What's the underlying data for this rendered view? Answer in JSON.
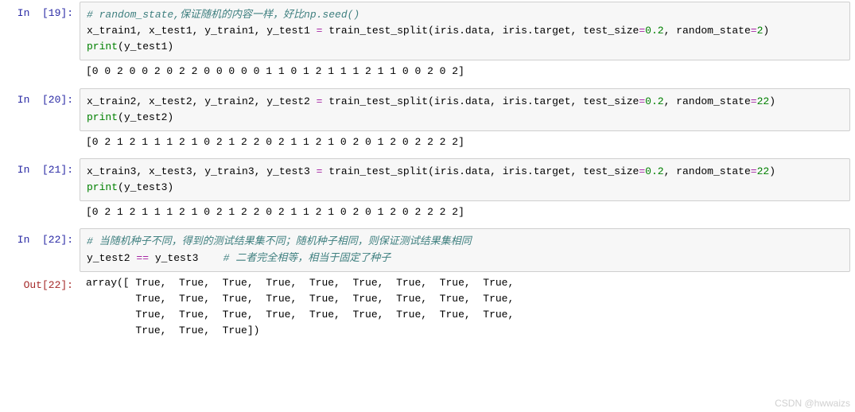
{
  "cells": [
    {
      "in_prompt": "In  [19]:",
      "code": {
        "l1_cmt": "# random_state,保证随机的内容一样，好比np.seed()",
        "l2_a": "x_train1, x_test1, y_train1, y_test1 ",
        "l2_eq": "=",
        "l2_b": " train_test_split(iris.data, iris.target, test_size",
        "l2_eq2": "=",
        "l2_n1": "0.2",
        "l2_c": ", random_state",
        "l2_eq3": "=",
        "l2_n2": "2",
        "l2_d": ")",
        "l3_a": "print",
        "l3_b": "(y_test1)"
      },
      "stdout": "[0 0 2 0 0 2 0 2 2 0 0 0 0 0 1 1 0 1 2 1 1 1 2 1 1 0 0 2 0 2]"
    },
    {
      "in_prompt": "In  [20]:",
      "code": {
        "l1_a": "x_train2, x_test2, y_train2, y_test2 ",
        "l1_eq": "=",
        "l1_b": " train_test_split(iris.data, iris.target, test_size",
        "l1_eq2": "=",
        "l1_n1": "0.2",
        "l1_c": ", random_state",
        "l1_eq3": "=",
        "l1_n2": "22",
        "l1_d": ")",
        "l2_a": "print",
        "l2_b": "(y_test2)"
      },
      "stdout": "[0 2 1 2 1 1 1 2 1 0 2 1 2 2 0 2 1 1 2 1 0 2 0 1 2 0 2 2 2 2]"
    },
    {
      "in_prompt": "In  [21]:",
      "code": {
        "l1_a": "x_train3, x_test3, y_train3, y_test3 ",
        "l1_eq": "=",
        "l1_b": " train_test_split(iris.data, iris.target, test_size",
        "l1_eq2": "=",
        "l1_n1": "0.2",
        "l1_c": ", random_state",
        "l1_eq3": "=",
        "l1_n2": "22",
        "l1_d": ")",
        "l2_a": "print",
        "l2_b": "(y_test3)"
      },
      "stdout": "[0 2 1 2 1 1 1 2 1 0 2 1 2 2 0 2 1 1 2 1 0 2 0 1 2 0 2 2 2 2]"
    },
    {
      "in_prompt": "In  [22]:",
      "code": {
        "l1_cmt": "# 当随机种子不同，得到的测试结果集不同；随机种子相同，则保证测试结果集相同",
        "l2_a": "y_test2 ",
        "l2_eq": "==",
        "l2_b": " y_test3    ",
        "l2_cmt": "# 二者完全相等，相当于固定了种子"
      },
      "out_prompt": "Out[22]:",
      "out_text": "array([ True,  True,  True,  True,  True,  True,  True,  True,  True,\n        True,  True,  True,  True,  True,  True,  True,  True,  True,\n        True,  True,  True,  True,  True,  True,  True,  True,  True,\n        True,  True,  True])"
    }
  ],
  "watermark": "CSDN @hwwaizs"
}
